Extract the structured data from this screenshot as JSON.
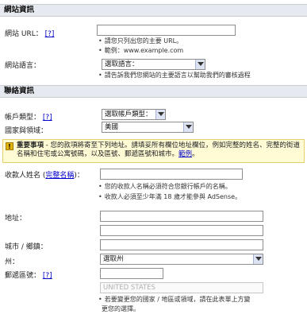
{
  "site_section": {
    "title": "網站資訊",
    "url_label": "網站 URL：",
    "url_help": "[?]",
    "url_value": "",
    "url_hint_1": "請您只列出您的主要 URL。",
    "url_hint_2": "範例：www.example.com",
    "language_label": "網站語言：",
    "language_selected": "選取語言：",
    "language_hint": "請告訴我們您網站的主要語言以幫助我們的審核過程"
  },
  "contact_section": {
    "title": "聯絡資訊",
    "account_type_label": "帳戶類型：",
    "account_type_help": "[?]",
    "account_type_selected": "選取帳戶類型：",
    "country_label": "國家與領域：",
    "country_selected": "美國",
    "warning_prefix": "重要事項",
    "warning_text": " - 您的款項將寄至下列地址。請填妥所有欄位地址欄位，例如完整的姓名、完整的街道名稱和住宅或公寓號碼，以及區號、郵遞區號和城市。",
    "warning_link": "範例",
    "warning_suffix": "。",
    "payee_label_prefix": "收款人姓名 (",
    "payee_label_link": "完整名稱",
    "payee_label_suffix": ")：",
    "payee_value": "",
    "payee_hint_1": "您的收款人名稱必須符合您銀行帳戶的名稱。",
    "payee_hint_2": "收款人必須至少年滿 18 歲才能參與 AdSense。",
    "address_label": "地址：",
    "address_line_1": "",
    "address_line_2": "",
    "city_label": "城市 / 鄉鎮：",
    "city_value": "",
    "state_label": "州：",
    "state_selected": "選取州",
    "zip_label": "郵遞區號：",
    "zip_help": "[?]",
    "zip_value": "",
    "country_readonly": "UNITED STATES",
    "country_hint_1": "若要變更您的國家 / 地區或領域，請在此表單上方變",
    "country_hint_2": "更您的選擇。"
  }
}
